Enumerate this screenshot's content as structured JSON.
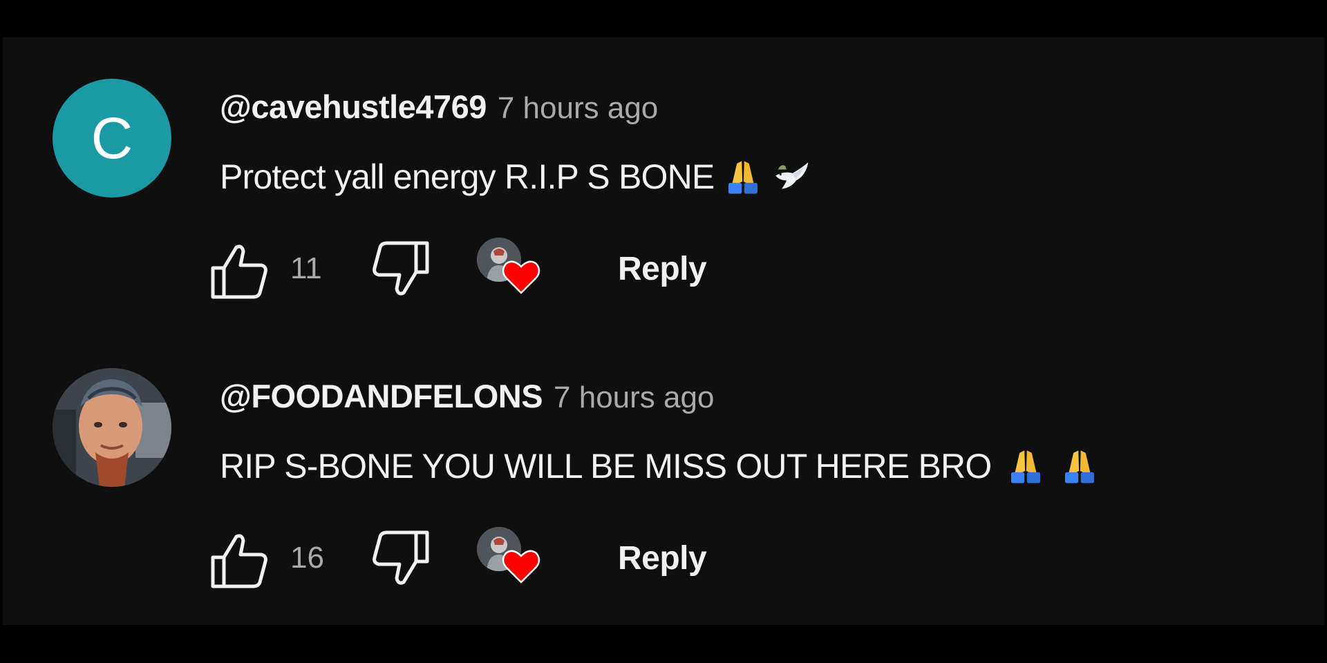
{
  "colors": {
    "background": "#0f0f0f",
    "text_primary": "#f1f1f1",
    "text_secondary": "#aaaaaa",
    "avatar_teal": "#1b9aa6",
    "heart_red": "#ff0000"
  },
  "comments": [
    {
      "avatar_letter": "C",
      "handle": "@cavehustle4769",
      "time": "7 hours ago",
      "text": "Protect yall energy R.I.P S BONE",
      "emojis": [
        "folded-hands-icon",
        "dove-icon"
      ],
      "likes": "11",
      "reply_label": "Reply"
    },
    {
      "avatar_letter": "",
      "handle": "@FOODANDFELONS",
      "time": "7 hours ago",
      "text": "RIP S-BONE YOU WILL BE MISS OUT HERE BRO",
      "emojis": [
        "folded-hands-icon",
        "folded-hands-icon"
      ],
      "likes": "16",
      "reply_label": "Reply"
    }
  ]
}
